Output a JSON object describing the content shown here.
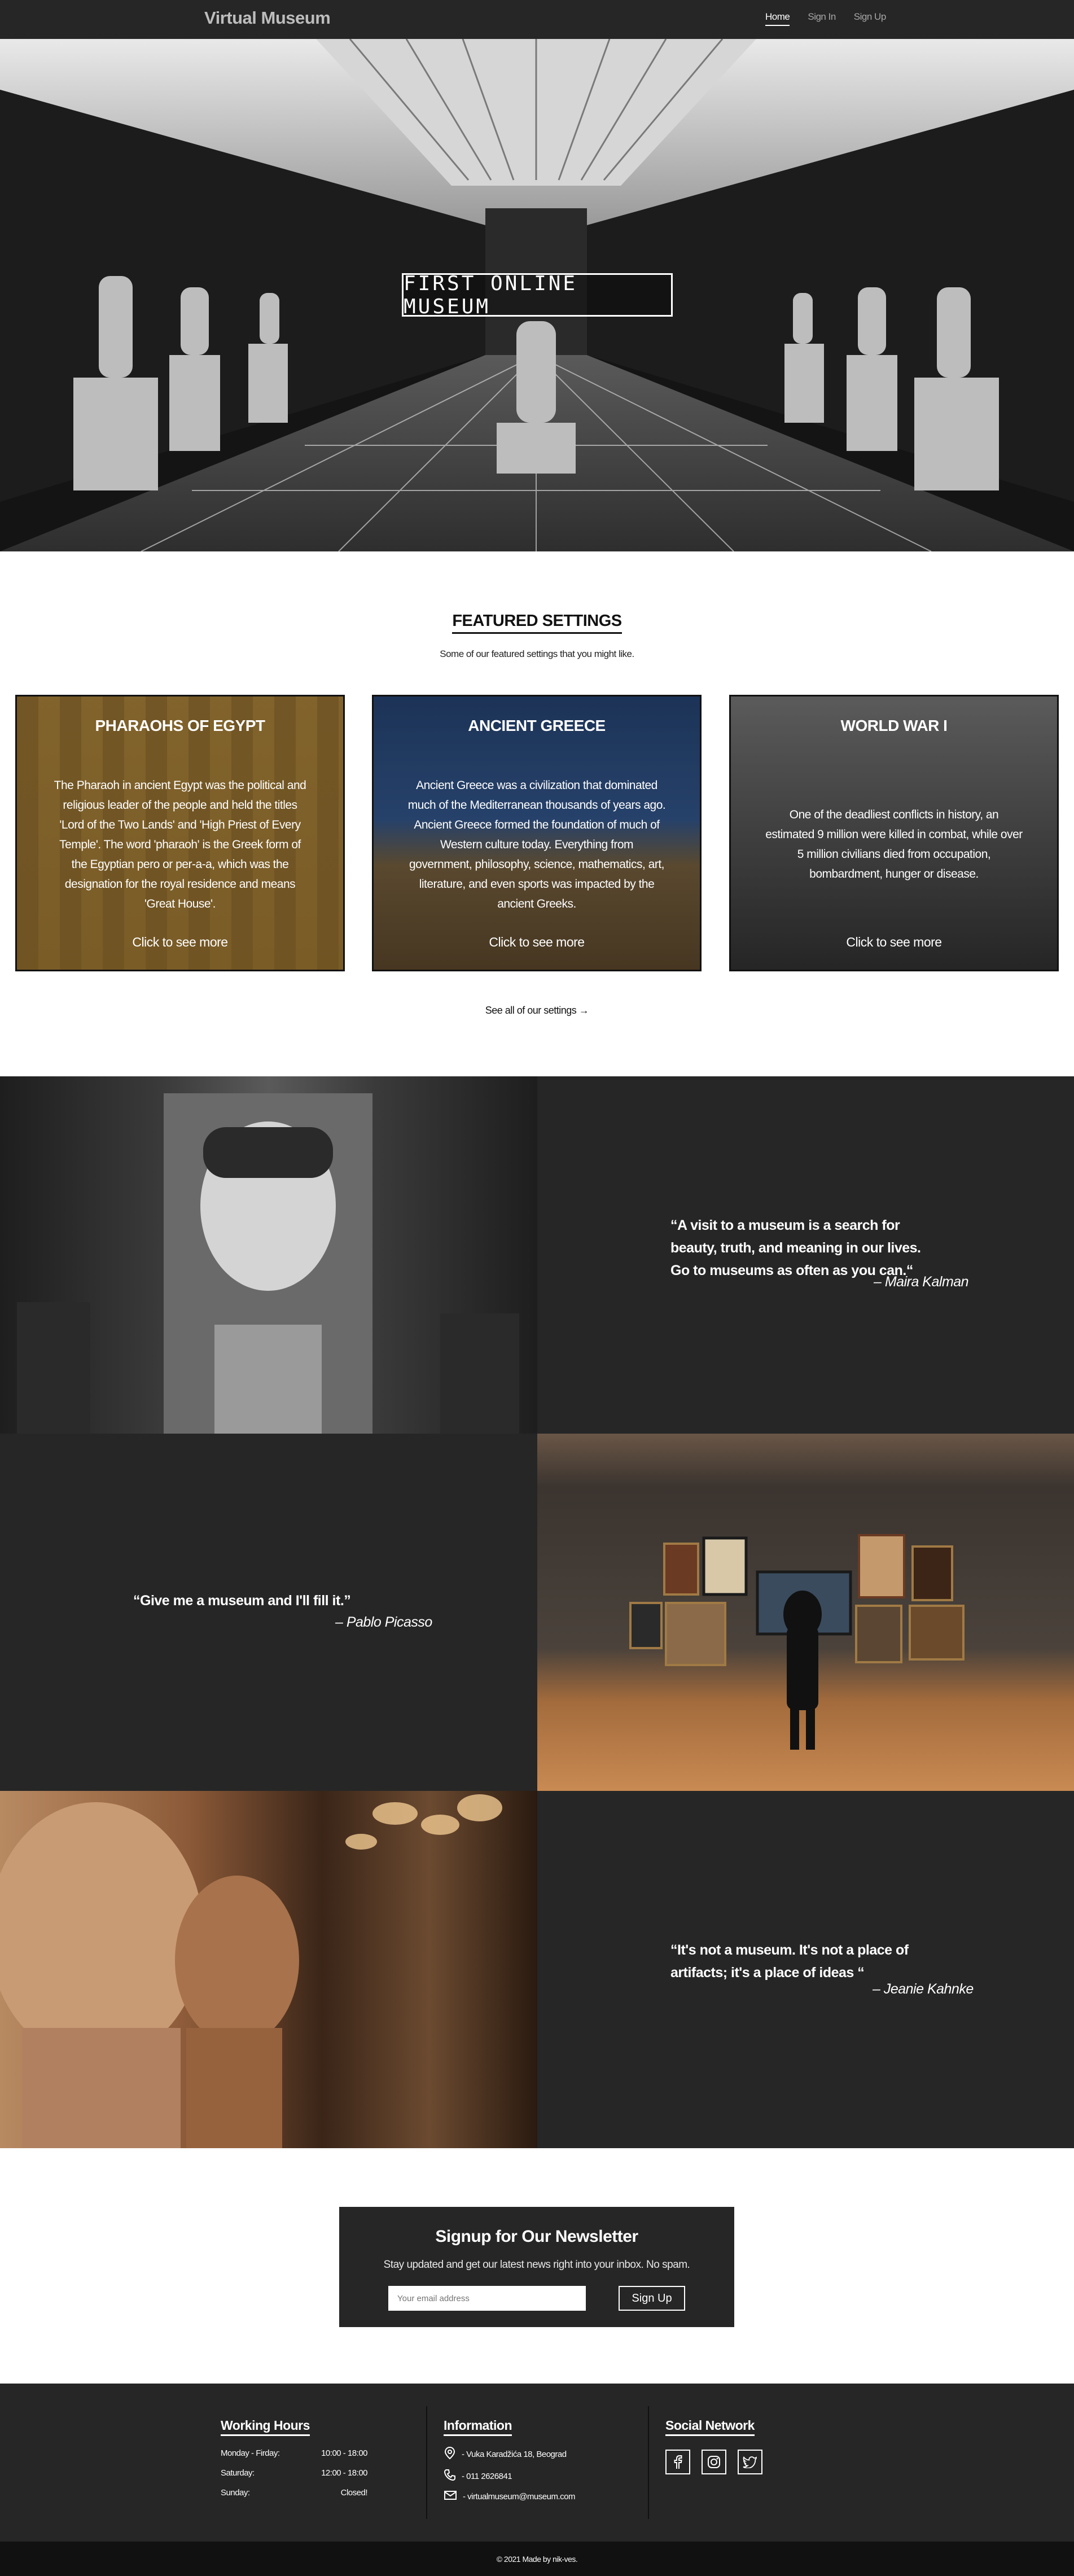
{
  "nav": {
    "brand": "Virtual Museum",
    "links": [
      "Home",
      "Sign In",
      "Sign Up"
    ]
  },
  "hero": {
    "title": "FIRST ONLINE MUSEUM"
  },
  "featured": {
    "title": "FEATURED SETTINGS",
    "subtitle": "Some of our featured settings that you might like.",
    "cards": [
      {
        "title": "PHARAOHS OF EGYPT",
        "text": "The Pharaoh in ancient Egypt was the political and religious leader of the people and held the titles 'Lord of the Two Lands' and 'High Priest of Every Temple'. The word 'pharaoh' is the Greek form of the Egyptian pero or per-a-a, which was the designation for the royal residence and means 'Great House'.",
        "link": "Click to see more"
      },
      {
        "title": "ANCIENT GREECE",
        "text": "Ancient Greece was a civilization that dominated much of the Mediterranean thousands of years ago. Ancient Greece formed the foundation of much of Western culture today. Everything from government, philosophy, science, mathematics, art, literature, and even sports was impacted by the ancient Greeks.",
        "link": "Click to see more"
      },
      {
        "title": "WORLD WAR I",
        "text": "One of the deadliest conflicts in history, an estimated 9 million were killed in combat, while over 5 million civilians died from occupation, bombardment, hunger or disease.",
        "link": "Click to see more"
      }
    ],
    "see_all": "See all of our settings →"
  },
  "quotes": [
    {
      "text": "“A visit to a museum is a search for beauty, truth, and meaning in our lives. Go to museums as often as you can.“",
      "author": "– Maira Kalman"
    },
    {
      "text": "“Give me a museum and I'll fill it.”",
      "author": "– Pablo Picasso"
    },
    {
      "text": "“It's not a museum. It's not a place of artifacts; it's a place of ideas “",
      "author": "– Jeanie Kahnke"
    }
  ],
  "newsletter": {
    "title": "Signup for Our Newsletter",
    "subtitle": "Stay updated and get our latest news right into your inbox. No spam.",
    "placeholder": "Your email address",
    "button": "Sign Up"
  },
  "footer": {
    "hours_title": "Working Hours",
    "hours": [
      {
        "day": "Monday - Firday:",
        "time": "10:00 - 18:00"
      },
      {
        "day": "Saturday:",
        "time": "12:00 - 18:00"
      },
      {
        "day": "Sunday:",
        "time": "Closed!"
      }
    ],
    "info_title": "Information",
    "info": [
      {
        "icon": "location-pin-icon",
        "text": "- Vuka Karadžića 18, Beograd"
      },
      {
        "icon": "phone-icon",
        "text": "- 011 2626841"
      },
      {
        "icon": "mail-icon",
        "text": "- virtualmuseum@museum.com"
      }
    ],
    "social_title": "Social Network",
    "socials": [
      "facebook-icon",
      "instagram-icon",
      "twitter-icon"
    ],
    "copyright": "© 2021 Made by nik-ves."
  }
}
